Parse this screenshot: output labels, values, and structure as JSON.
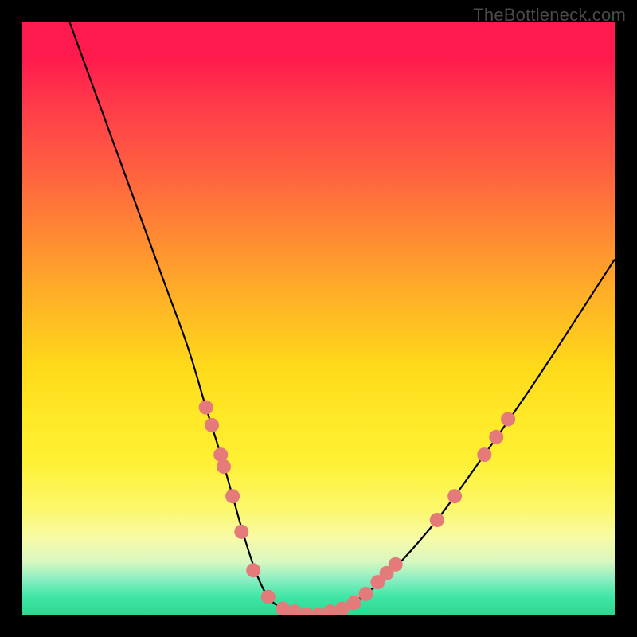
{
  "watermark": "TheBottleneck.com",
  "chart_data": {
    "type": "line",
    "title": "",
    "xlabel": "",
    "ylabel": "",
    "xlim": [
      0,
      100
    ],
    "ylim": [
      0,
      100
    ],
    "curve": {
      "name": "bottleneck-curve",
      "x": [
        8,
        12,
        16,
        20,
        24,
        28,
        31,
        33.5,
        35.5,
        37.5,
        39.5,
        41.5,
        44,
        47.5,
        51,
        54,
        58,
        63,
        70,
        78,
        87,
        100
      ],
      "y": [
        100,
        89,
        78,
        67,
        56,
        45,
        35,
        27,
        20,
        13,
        7,
        3,
        1,
        0,
        0,
        1,
        3.5,
        8,
        16,
        27,
        40,
        60
      ]
    },
    "markers": {
      "name": "scatter-points",
      "color": "#e47a7a",
      "radius": 9,
      "points": [
        {
          "x": 31.0,
          "y": 35.0
        },
        {
          "x": 32.0,
          "y": 32.0
        },
        {
          "x": 33.5,
          "y": 27.0
        },
        {
          "x": 34.0,
          "y": 25.0
        },
        {
          "x": 35.5,
          "y": 20.0
        },
        {
          "x": 37.0,
          "y": 14.0
        },
        {
          "x": 39.0,
          "y": 7.5
        },
        {
          "x": 41.5,
          "y": 3.0
        },
        {
          "x": 44.0,
          "y": 1.0
        },
        {
          "x": 46.0,
          "y": 0.5
        },
        {
          "x": 48.0,
          "y": 0.0
        },
        {
          "x": 50.0,
          "y": 0.0
        },
        {
          "x": 52.0,
          "y": 0.5
        },
        {
          "x": 54.0,
          "y": 1.0
        },
        {
          "x": 56.0,
          "y": 2.0
        },
        {
          "x": 58.0,
          "y": 3.5
        },
        {
          "x": 60.0,
          "y": 5.5
        },
        {
          "x": 61.5,
          "y": 7.0
        },
        {
          "x": 63.0,
          "y": 8.5
        },
        {
          "x": 70.0,
          "y": 16.0
        },
        {
          "x": 73.0,
          "y": 20.0
        },
        {
          "x": 78.0,
          "y": 27.0
        },
        {
          "x": 80.0,
          "y": 30.0
        },
        {
          "x": 82.0,
          "y": 33.0
        }
      ]
    }
  }
}
